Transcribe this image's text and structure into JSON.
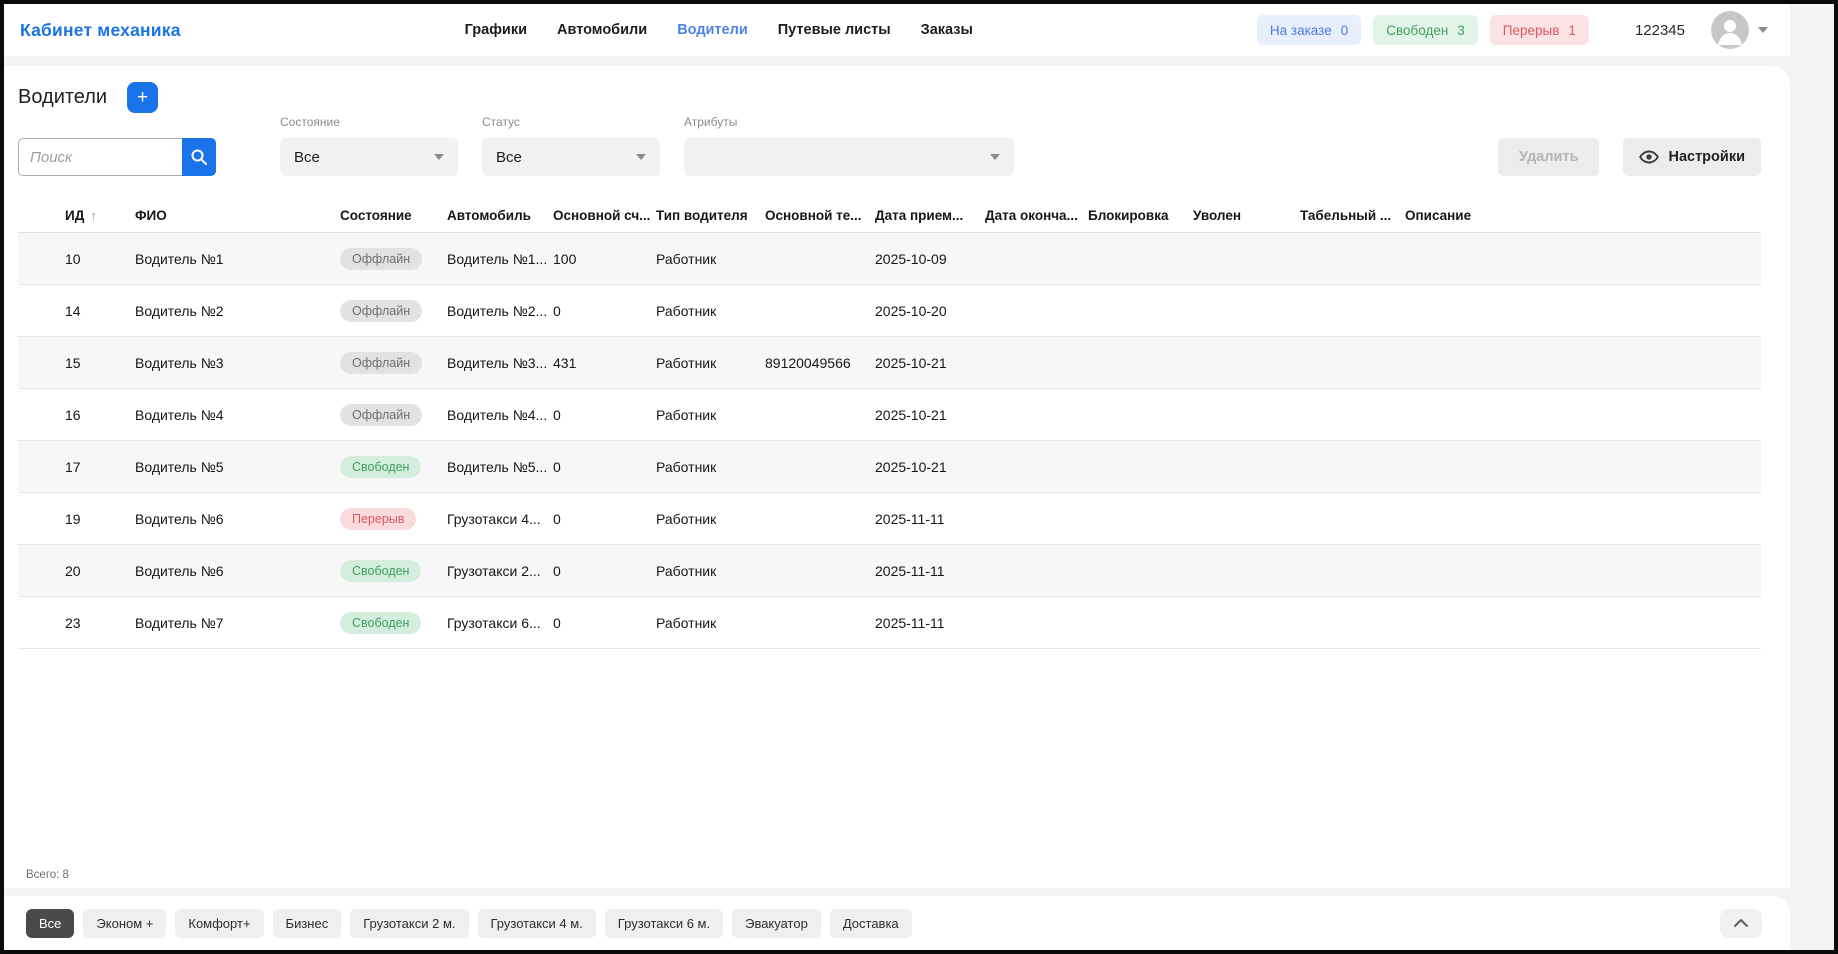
{
  "header": {
    "brand": "Кабинет механика",
    "nav": [
      {
        "label": "Графики",
        "active": false
      },
      {
        "label": "Автомобили",
        "active": false
      },
      {
        "label": "Водители",
        "active": true
      },
      {
        "label": "Путевые листы",
        "active": false
      },
      {
        "label": "Заказы",
        "active": false
      }
    ],
    "status_chips": [
      {
        "label": "На заказе",
        "count": "0",
        "bg": "#e8eefc",
        "color": "#4b7de0"
      },
      {
        "label": "Свободен",
        "count": "3",
        "bg": "#e2f3e8",
        "color": "#41a05f"
      },
      {
        "label": "Перерыв",
        "count": "1",
        "bg": "#fbe2e4",
        "color": "#dd5860"
      }
    ],
    "user_id": "122345"
  },
  "toolbar": {
    "page_title": "Водители",
    "add_label": "+",
    "search_placeholder": "Поиск",
    "filters": [
      {
        "label": "Состояние",
        "value": "Все"
      },
      {
        "label": "Статус",
        "value": "Все"
      },
      {
        "label": "Атрибуты",
        "value": ""
      }
    ],
    "delete_label": "Удалить",
    "settings_label": "Настройки"
  },
  "table": {
    "sort": {
      "column": "ИД",
      "direction": "asc"
    },
    "columns": [
      {
        "key": "id",
        "label": "ИД"
      },
      {
        "key": "fio",
        "label": "ФИО"
      },
      {
        "key": "state",
        "label": "Состояние"
      },
      {
        "key": "car",
        "label": "Автомобиль"
      },
      {
        "key": "account",
        "label": "Основной сч..."
      },
      {
        "key": "type",
        "label": "Тип водителя"
      },
      {
        "key": "phone",
        "label": "Основной те..."
      },
      {
        "key": "hire_date",
        "label": "Дата прием..."
      },
      {
        "key": "end_date",
        "label": "Дата оконча..."
      },
      {
        "key": "block",
        "label": "Блокировка"
      },
      {
        "key": "fired",
        "label": "Уволен"
      },
      {
        "key": "tab_number",
        "label": "Табельный ..."
      },
      {
        "key": "description",
        "label": "Описание"
      }
    ],
    "rows": [
      {
        "id": "10",
        "fio": "Водитель №1",
        "state": "Оффлайн",
        "state_type": "offline",
        "car": "Водитель №1...",
        "account": "100",
        "type": "Работник",
        "phone": "",
        "hire_date": "2025-10-09",
        "end_date": "",
        "block": "",
        "fired": "",
        "tab_number": "",
        "description": ""
      },
      {
        "id": "14",
        "fio": "Водитель №2",
        "state": "Оффлайн",
        "state_type": "offline",
        "car": "Водитель №2...",
        "account": "0",
        "type": "Работник",
        "phone": "",
        "hire_date": "2025-10-20",
        "end_date": "",
        "block": "",
        "fired": "",
        "tab_number": "",
        "description": ""
      },
      {
        "id": "15",
        "fio": "Водитель №3",
        "state": "Оффлайн",
        "state_type": "offline",
        "car": "Водитель №3...",
        "account": "431",
        "type": "Работник",
        "phone": "89120049566",
        "hire_date": "2025-10-21",
        "end_date": "",
        "block": "",
        "fired": "",
        "tab_number": "",
        "description": ""
      },
      {
        "id": "16",
        "fio": "Водитель №4",
        "state": "Оффлайн",
        "state_type": "offline",
        "car": "Водитель №4...",
        "account": "0",
        "type": "Работник",
        "phone": "",
        "hire_date": "2025-10-21",
        "end_date": "",
        "block": "",
        "fired": "",
        "tab_number": "",
        "description": ""
      },
      {
        "id": "17",
        "fio": "Водитель №5",
        "state": "Свободен",
        "state_type": "free",
        "car": "Водитель №5...",
        "account": "0",
        "type": "Работник",
        "phone": "",
        "hire_date": "2025-10-21",
        "end_date": "",
        "block": "",
        "fired": "",
        "tab_number": "",
        "description": ""
      },
      {
        "id": "19",
        "fio": "Водитель №6",
        "state": "Перерыв",
        "state_type": "break",
        "car": "Грузотакси 4...",
        "account": "0",
        "type": "Работник",
        "phone": "",
        "hire_date": "2025-11-11",
        "end_date": "",
        "block": "",
        "fired": "",
        "tab_number": "",
        "description": ""
      },
      {
        "id": "20",
        "fio": "Водитель №6",
        "state": "Свободен",
        "state_type": "free",
        "car": "Грузотакси 2...",
        "account": "0",
        "type": "Работник",
        "phone": "",
        "hire_date": "2025-11-11",
        "end_date": "",
        "block": "",
        "fired": "",
        "tab_number": "",
        "description": ""
      },
      {
        "id": "23",
        "fio": "Водитель №7",
        "state": "Свободен",
        "state_type": "free",
        "car": "Грузотакси 6...",
        "account": "0",
        "type": "Работник",
        "phone": "",
        "hire_date": "2025-11-11",
        "end_date": "",
        "block": "",
        "fired": "",
        "tab_number": "",
        "description": ""
      }
    ],
    "total_label": "Всего: 8"
  },
  "footer": {
    "tabs": [
      {
        "label": "Все",
        "active": true
      },
      {
        "label": "Эконом +",
        "active": false
      },
      {
        "label": "Комфорт+",
        "active": false
      },
      {
        "label": "Бизнес",
        "active": false
      },
      {
        "label": "Грузотакси 2 м.",
        "active": false
      },
      {
        "label": "Грузотакси 4 м.",
        "active": false
      },
      {
        "label": "Грузотакси 6 м.",
        "active": false
      },
      {
        "label": "Эвакуатор",
        "active": false
      },
      {
        "label": "Доставка",
        "active": false
      }
    ]
  },
  "colors": {
    "accent": "#1a73e8",
    "badge_offline_bg": "#e2e2e2",
    "badge_offline_text": "#6f6f6f",
    "badge_free_bg": "#d4eedd",
    "badge_free_text": "#3f9e61",
    "badge_break_bg": "#f9dadd",
    "badge_break_text": "#dd545f",
    "active_tab_bg": "#4a4a4a"
  }
}
